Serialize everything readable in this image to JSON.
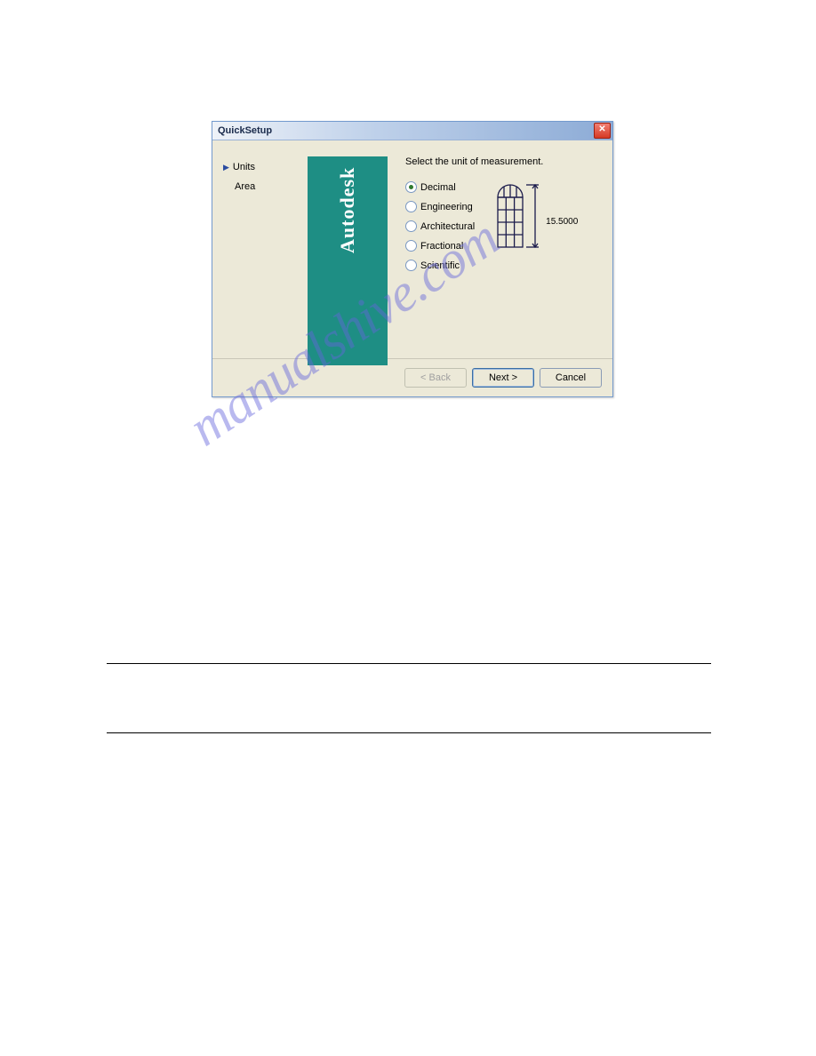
{
  "dialog": {
    "title": "QuickSetup",
    "close_symbol": "✕",
    "nav": {
      "units": "Units",
      "area": "Area"
    },
    "brand": "Autodesk",
    "instruction": "Select the unit of measurement.",
    "options": {
      "decimal": "Decimal",
      "engineering": "Engineering",
      "architectural": "Architectural",
      "fractional": "Fractional",
      "scientific": "Scientific"
    },
    "dimension_value": "15.5000",
    "buttons": {
      "back": "< Back",
      "next": "Next >",
      "cancel": "Cancel"
    }
  },
  "watermark": "manualshive.com"
}
